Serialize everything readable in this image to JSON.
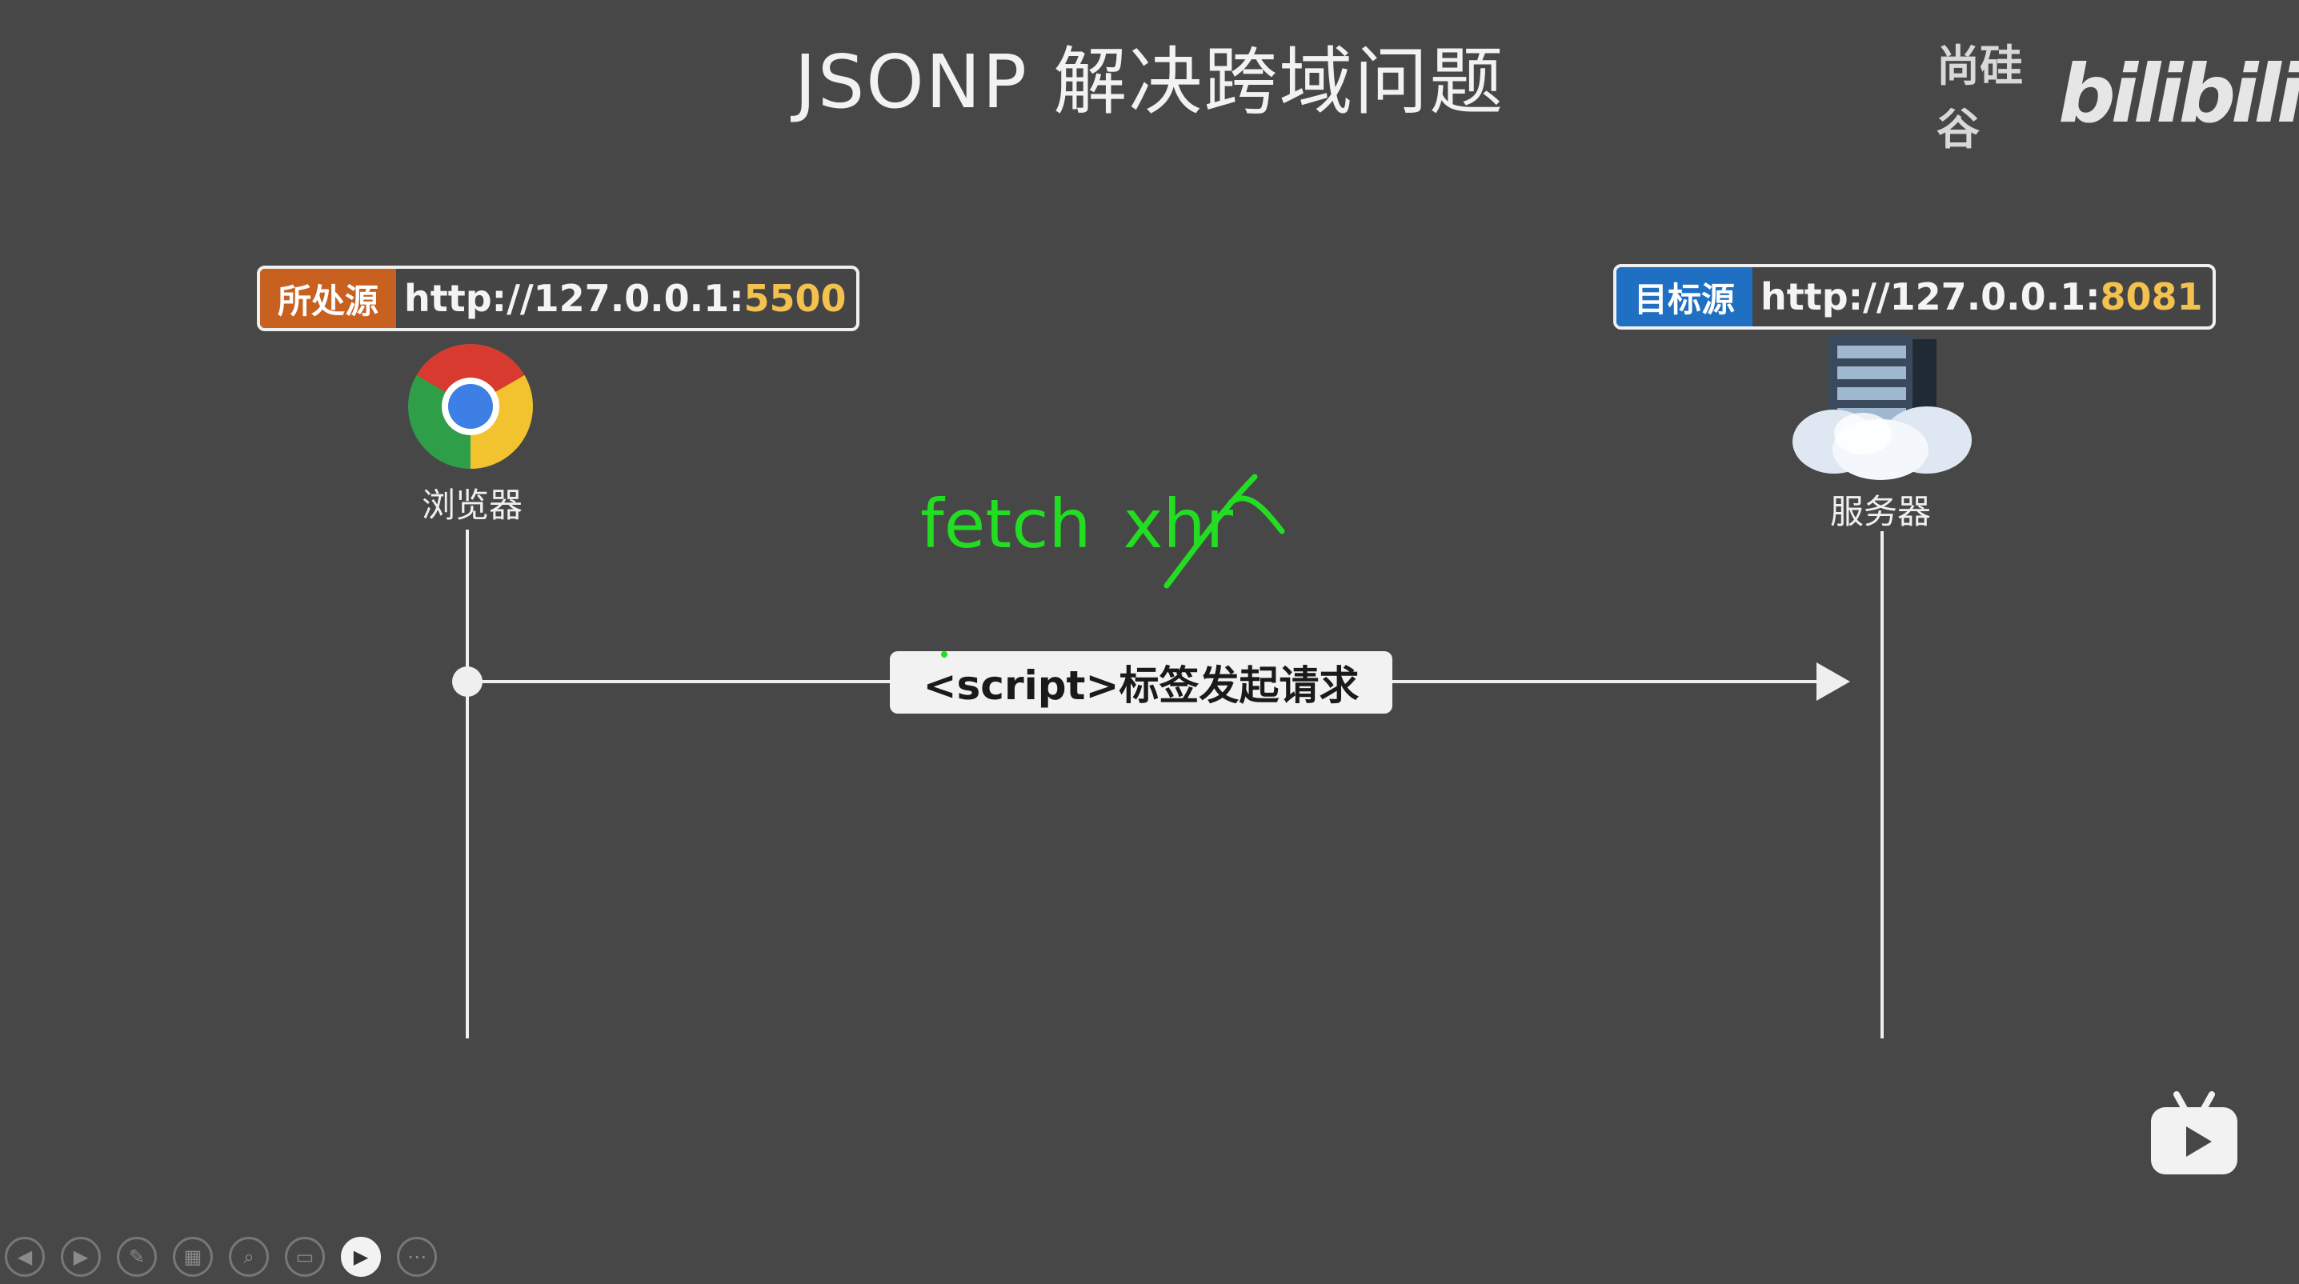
{
  "slide": {
    "title": "JSONP 解决跨域问题"
  },
  "brand": {
    "name": "尚硅谷",
    "logo_text": "bilibili"
  },
  "source_origin": {
    "label": "所处源",
    "url_prefix": "http://127.0.0.1:",
    "port": "5500"
  },
  "target_origin": {
    "label": "目标源",
    "url_prefix": "http://127.0.0.1:",
    "port": "8081"
  },
  "browser": {
    "label": "浏览器",
    "icon": "chrome-icon"
  },
  "server": {
    "label": "服务器",
    "icon": "cloud-server-icon"
  },
  "request": {
    "label": "<script>标签发起请求"
  },
  "annotation": {
    "fetch": "fetch",
    "xhr": "xhr",
    "color": "#22dd22"
  },
  "colors": {
    "background": "#474747",
    "source_accent": "#c8611f",
    "target_accent": "#1f6fc2",
    "port": "#f2c14e"
  },
  "toolbar": {
    "buttons": [
      {
        "icon": "previous-icon"
      },
      {
        "icon": "next-icon"
      },
      {
        "icon": "pen-icon"
      },
      {
        "icon": "slides-grid-icon"
      },
      {
        "icon": "zoom-icon"
      },
      {
        "icon": "subtitle-icon"
      },
      {
        "icon": "camera-icon",
        "active": true
      },
      {
        "icon": "more-icon"
      }
    ]
  }
}
